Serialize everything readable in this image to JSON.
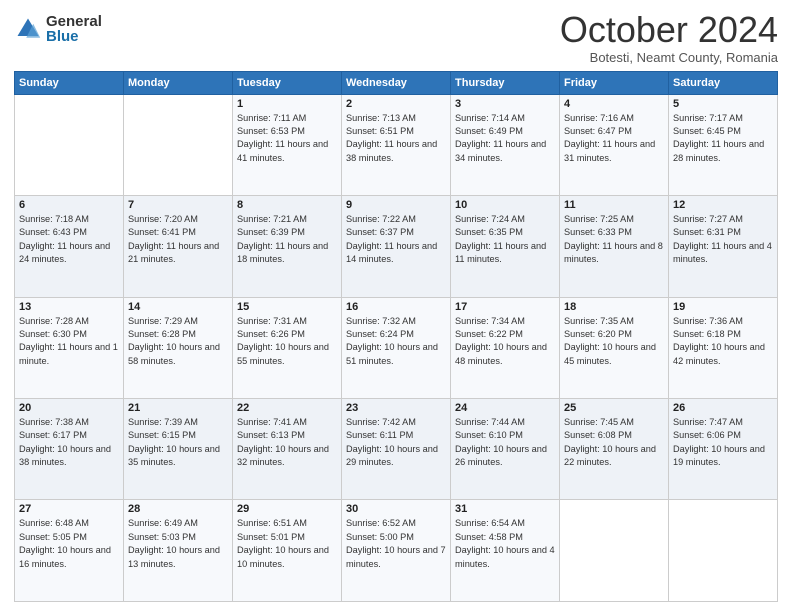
{
  "header": {
    "logo_general": "General",
    "logo_blue": "Blue",
    "month_title": "October 2024",
    "location": "Botesti, Neamt County, Romania"
  },
  "weekdays": [
    "Sunday",
    "Monday",
    "Tuesday",
    "Wednesday",
    "Thursday",
    "Friday",
    "Saturday"
  ],
  "weeks": [
    [
      {
        "day": "",
        "text": ""
      },
      {
        "day": "",
        "text": ""
      },
      {
        "day": "1",
        "text": "Sunrise: 7:11 AM\nSunset: 6:53 PM\nDaylight: 11 hours and 41 minutes."
      },
      {
        "day": "2",
        "text": "Sunrise: 7:13 AM\nSunset: 6:51 PM\nDaylight: 11 hours and 38 minutes."
      },
      {
        "day": "3",
        "text": "Sunrise: 7:14 AM\nSunset: 6:49 PM\nDaylight: 11 hours and 34 minutes."
      },
      {
        "day": "4",
        "text": "Sunrise: 7:16 AM\nSunset: 6:47 PM\nDaylight: 11 hours and 31 minutes."
      },
      {
        "day": "5",
        "text": "Sunrise: 7:17 AM\nSunset: 6:45 PM\nDaylight: 11 hours and 28 minutes."
      }
    ],
    [
      {
        "day": "6",
        "text": "Sunrise: 7:18 AM\nSunset: 6:43 PM\nDaylight: 11 hours and 24 minutes."
      },
      {
        "day": "7",
        "text": "Sunrise: 7:20 AM\nSunset: 6:41 PM\nDaylight: 11 hours and 21 minutes."
      },
      {
        "day": "8",
        "text": "Sunrise: 7:21 AM\nSunset: 6:39 PM\nDaylight: 11 hours and 18 minutes."
      },
      {
        "day": "9",
        "text": "Sunrise: 7:22 AM\nSunset: 6:37 PM\nDaylight: 11 hours and 14 minutes."
      },
      {
        "day": "10",
        "text": "Sunrise: 7:24 AM\nSunset: 6:35 PM\nDaylight: 11 hours and 11 minutes."
      },
      {
        "day": "11",
        "text": "Sunrise: 7:25 AM\nSunset: 6:33 PM\nDaylight: 11 hours and 8 minutes."
      },
      {
        "day": "12",
        "text": "Sunrise: 7:27 AM\nSunset: 6:31 PM\nDaylight: 11 hours and 4 minutes."
      }
    ],
    [
      {
        "day": "13",
        "text": "Sunrise: 7:28 AM\nSunset: 6:30 PM\nDaylight: 11 hours and 1 minute."
      },
      {
        "day": "14",
        "text": "Sunrise: 7:29 AM\nSunset: 6:28 PM\nDaylight: 10 hours and 58 minutes."
      },
      {
        "day": "15",
        "text": "Sunrise: 7:31 AM\nSunset: 6:26 PM\nDaylight: 10 hours and 55 minutes."
      },
      {
        "day": "16",
        "text": "Sunrise: 7:32 AM\nSunset: 6:24 PM\nDaylight: 10 hours and 51 minutes."
      },
      {
        "day": "17",
        "text": "Sunrise: 7:34 AM\nSunset: 6:22 PM\nDaylight: 10 hours and 48 minutes."
      },
      {
        "day": "18",
        "text": "Sunrise: 7:35 AM\nSunset: 6:20 PM\nDaylight: 10 hours and 45 minutes."
      },
      {
        "day": "19",
        "text": "Sunrise: 7:36 AM\nSunset: 6:18 PM\nDaylight: 10 hours and 42 minutes."
      }
    ],
    [
      {
        "day": "20",
        "text": "Sunrise: 7:38 AM\nSunset: 6:17 PM\nDaylight: 10 hours and 38 minutes."
      },
      {
        "day": "21",
        "text": "Sunrise: 7:39 AM\nSunset: 6:15 PM\nDaylight: 10 hours and 35 minutes."
      },
      {
        "day": "22",
        "text": "Sunrise: 7:41 AM\nSunset: 6:13 PM\nDaylight: 10 hours and 32 minutes."
      },
      {
        "day": "23",
        "text": "Sunrise: 7:42 AM\nSunset: 6:11 PM\nDaylight: 10 hours and 29 minutes."
      },
      {
        "day": "24",
        "text": "Sunrise: 7:44 AM\nSunset: 6:10 PM\nDaylight: 10 hours and 26 minutes."
      },
      {
        "day": "25",
        "text": "Sunrise: 7:45 AM\nSunset: 6:08 PM\nDaylight: 10 hours and 22 minutes."
      },
      {
        "day": "26",
        "text": "Sunrise: 7:47 AM\nSunset: 6:06 PM\nDaylight: 10 hours and 19 minutes."
      }
    ],
    [
      {
        "day": "27",
        "text": "Sunrise: 6:48 AM\nSunset: 5:05 PM\nDaylight: 10 hours and 16 minutes."
      },
      {
        "day": "28",
        "text": "Sunrise: 6:49 AM\nSunset: 5:03 PM\nDaylight: 10 hours and 13 minutes."
      },
      {
        "day": "29",
        "text": "Sunrise: 6:51 AM\nSunset: 5:01 PM\nDaylight: 10 hours and 10 minutes."
      },
      {
        "day": "30",
        "text": "Sunrise: 6:52 AM\nSunset: 5:00 PM\nDaylight: 10 hours and 7 minutes."
      },
      {
        "day": "31",
        "text": "Sunrise: 6:54 AM\nSunset: 4:58 PM\nDaylight: 10 hours and 4 minutes."
      },
      {
        "day": "",
        "text": ""
      },
      {
        "day": "",
        "text": ""
      }
    ]
  ]
}
